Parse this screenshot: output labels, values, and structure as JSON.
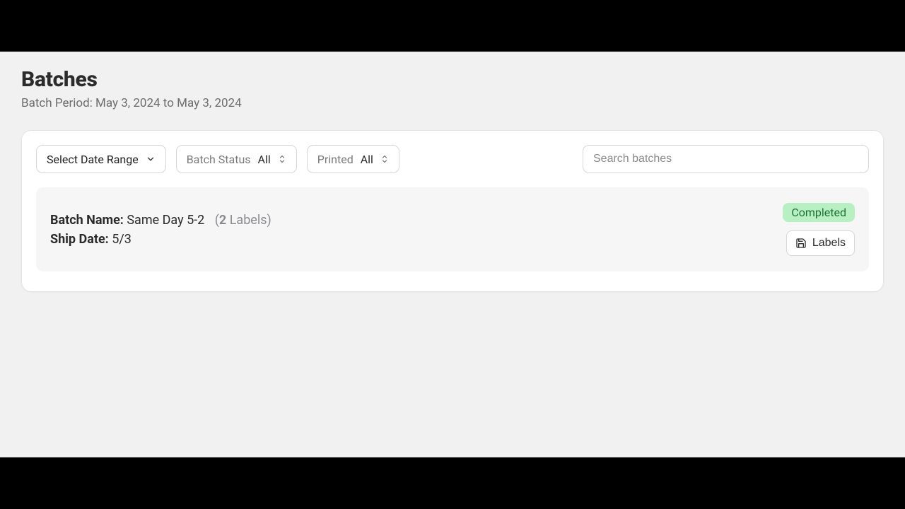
{
  "header": {
    "title": "Batches",
    "subtitle": "Batch Period: May 3, 2024 to May 3, 2024"
  },
  "toolbar": {
    "date_range_label": "Select Date Range",
    "batch_status_label": "Batch Status",
    "batch_status_value": "All",
    "printed_label": "Printed",
    "printed_value": "All",
    "search_placeholder": "Search batches"
  },
  "batch": {
    "name_label": "Batch Name:",
    "name_value": "Same Day 5-2",
    "labels_count": "2",
    "labels_word": "Labels",
    "ship_label": "Ship Date:",
    "ship_value": "5/3",
    "status": "Completed",
    "labels_button": "Labels"
  }
}
